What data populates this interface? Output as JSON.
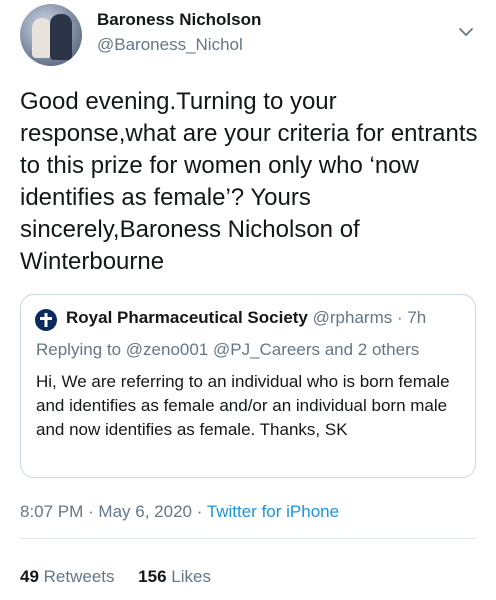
{
  "author": {
    "name": "Baroness Nicholson",
    "handle": "@Baroness_Nichol"
  },
  "tweet": {
    "text": "Good evening.Turning to your response,what are your criteria for entrants to this prize for women only who ‘now identifies as female’? Yours sincerely,Baroness Nicholson of Winterbourne"
  },
  "quoted": {
    "name": "Royal Pharmaceutical Society",
    "handle": "@rpharms",
    "time": "· 7h",
    "replying_to": "Replying to @zeno001 @PJ_Careers and 2 others",
    "text": "Hi, We are referring to an individual who is born female and identifies as female and/or an individual born male and now identifies as female. Thanks, SK"
  },
  "meta": {
    "timestamp": "8:07 PM · May 6, 2020 · ",
    "source": "Twitter for iPhone"
  },
  "stats": {
    "retweets_count": "49",
    "retweets_label": "Retweets",
    "likes_count": "156",
    "likes_label": "Likes"
  },
  "colors": {
    "secondary_text": "#657786",
    "link": "#1b95e0",
    "border": "#ccd6dd"
  }
}
